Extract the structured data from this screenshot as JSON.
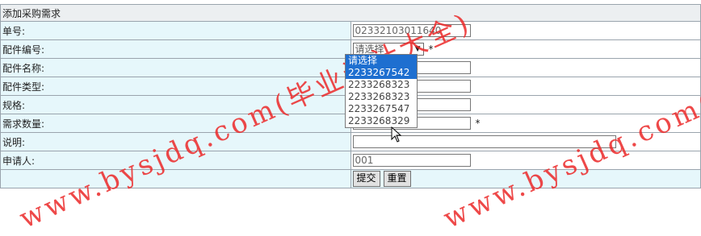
{
  "form": {
    "title": "添加采购需求",
    "rows": {
      "order_no": {
        "label": "单号:",
        "value": "02332103011640"
      },
      "part_no": {
        "label": "配件编号:",
        "selected": "请选择",
        "required": "*"
      },
      "part_name": {
        "label": "配件名称:"
      },
      "part_type": {
        "label": "配件类型:"
      },
      "spec": {
        "label": "规格:"
      },
      "quantity": {
        "label": "需求数量:",
        "required": "*"
      },
      "remark": {
        "label": "说明:"
      },
      "applicant": {
        "label": "申请人:",
        "value": "001"
      }
    },
    "buttons": {
      "submit": "提交",
      "reset": "重置"
    }
  },
  "dropdown": {
    "options": [
      "请选择",
      "2233267542",
      "2233268323",
      "2233268323",
      "2233267547",
      "2233268329"
    ],
    "highlighted_index": 1
  },
  "watermark": {
    "text": "www.bysjdq.com(毕业设计大全)",
    "color": "#eb2828"
  }
}
